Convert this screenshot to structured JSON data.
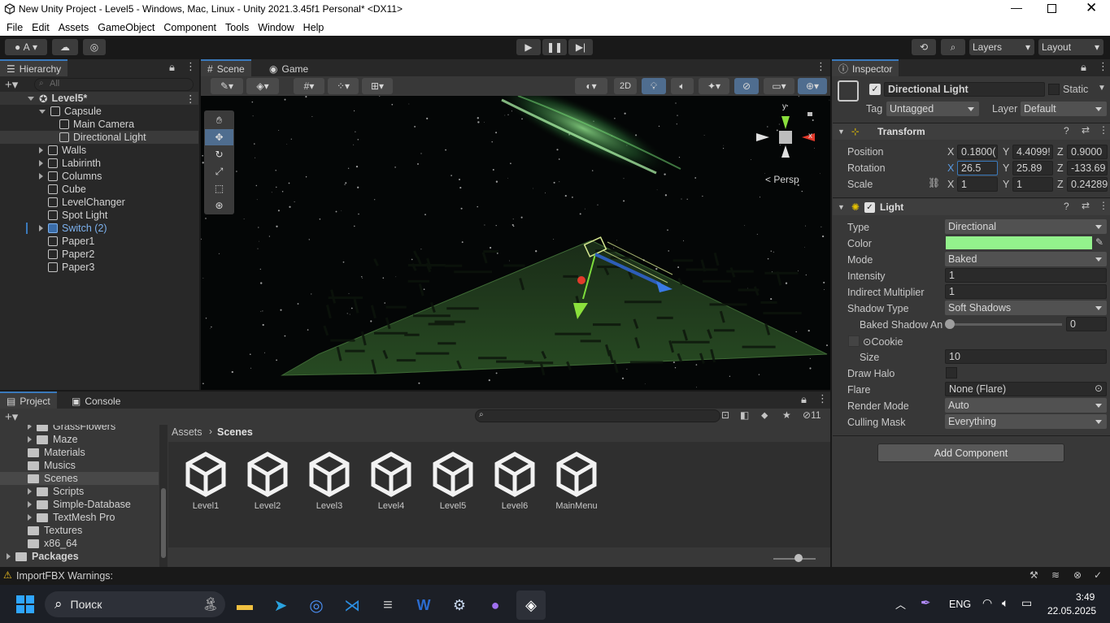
{
  "window": {
    "title": "New Unity Project - Level5 - Windows, Mac, Linux - Unity 2021.3.45f1 Personal* <DX11>"
  },
  "menu": [
    "File",
    "Edit",
    "Assets",
    "GameObject",
    "Component",
    "Tools",
    "Window",
    "Help"
  ],
  "toolbar": {
    "account": "A",
    "layers": "Layers",
    "layout": "Layout"
  },
  "hierarchy": {
    "tab": "Hierarchy",
    "search_placeholder": "All",
    "items": [
      {
        "label": "Level5*",
        "depth": 0,
        "expand": "down",
        "root": true
      },
      {
        "label": "Capsule",
        "depth": 1,
        "expand": "down"
      },
      {
        "label": "Main Camera",
        "depth": 2,
        "expand": ""
      },
      {
        "label": "Directional Light",
        "depth": 2,
        "expand": "",
        "selected": true
      },
      {
        "label": "Walls",
        "depth": 1,
        "expand": "right"
      },
      {
        "label": "Labirinth",
        "depth": 1,
        "expand": "right"
      },
      {
        "label": "Columns",
        "depth": 1,
        "expand": "right"
      },
      {
        "label": "Cube",
        "depth": 1,
        "expand": ""
      },
      {
        "label": "LevelChanger",
        "depth": 1,
        "expand": ""
      },
      {
        "label": "Spot Light",
        "depth": 1,
        "expand": ""
      },
      {
        "label": "Switch (2)",
        "depth": 1,
        "expand": "right",
        "prefab": true
      },
      {
        "label": "Paper1",
        "depth": 1,
        "expand": ""
      },
      {
        "label": "Paper2",
        "depth": 1,
        "expand": ""
      },
      {
        "label": "Paper3",
        "depth": 1,
        "expand": ""
      }
    ]
  },
  "scene": {
    "tab_scene": "Scene",
    "tab_game": "Game",
    "btn_2d": "2D",
    "persp": "Persp",
    "gizmo_y": "y",
    "gizmo_x": "x"
  },
  "inspector": {
    "tab": "Inspector",
    "object_name": "Directional Light",
    "static_label": "Static",
    "tag_label": "Tag",
    "tag_value": "Untagged",
    "layer_label": "Layer",
    "layer_value": "Default",
    "transform": {
      "title": "Transform",
      "position_label": "Position",
      "px": "0.1800(",
      "py": "4.4099!",
      "pz": "0.9000",
      "rotation_label": "Rotation",
      "rx": "26.5",
      "ry": "25.89",
      "rz": "-133.69",
      "scale_label": "Scale",
      "sx": "1",
      "sy": "1",
      "sz": "0.24289",
      "x": "X",
      "y": "Y",
      "z": "Z"
    },
    "light": {
      "title": "Light",
      "type_label": "Type",
      "type_value": "Directional",
      "color_label": "Color",
      "color_hex": "#93f28c",
      "mode_label": "Mode",
      "mode_value": "Baked",
      "intensity_label": "Intensity",
      "intensity_value": "1",
      "indirect_label": "Indirect Multiplier",
      "indirect_value": "1",
      "shadow_label": "Shadow Type",
      "shadow_value": "Soft Shadows",
      "baked_shadow_label": "Baked Shadow An",
      "baked_shadow_value": "0",
      "cookie_label": "Cookie",
      "size_label": "Size",
      "size_value": "10",
      "halo_label": "Draw Halo",
      "flare_label": "Flare",
      "flare_value": "None (Flare)",
      "render_label": "Render Mode",
      "render_value": "Auto",
      "culling_label": "Culling Mask",
      "culling_value": "Everything"
    },
    "add_component": "Add Component"
  },
  "project": {
    "tab_project": "Project",
    "tab_console": "Console",
    "tree": [
      {
        "label": "GrassFlowers",
        "depth": 1,
        "expand": "right"
      },
      {
        "label": "Maze",
        "depth": 1,
        "expand": "right"
      },
      {
        "label": "Materials",
        "depth": 1,
        "expand": ""
      },
      {
        "label": "Musics",
        "depth": 1,
        "expand": ""
      },
      {
        "label": "Scenes",
        "depth": 1,
        "expand": "",
        "selected": true
      },
      {
        "label": "Scripts",
        "depth": 1,
        "expand": "right"
      },
      {
        "label": "Simple-Database",
        "depth": 1,
        "expand": "right"
      },
      {
        "label": "TextMesh Pro",
        "depth": 1,
        "expand": "right"
      },
      {
        "label": "Textures",
        "depth": 1,
        "expand": ""
      },
      {
        "label": "x86_64",
        "depth": 1,
        "expand": ""
      },
      {
        "label": "Packages",
        "depth": 0,
        "expand": "right",
        "bold": true
      }
    ],
    "breadcrumb_root": "Assets",
    "breadcrumb_current": "Scenes",
    "hidden_count": "11",
    "assets": [
      "Level1",
      "Level2",
      "Level3",
      "Level4",
      "Level5",
      "Level6",
      "MainMenu"
    ]
  },
  "status": {
    "warning": "ImportFBX Warnings:"
  },
  "taskbar": {
    "search": "Поиск",
    "lang": "ENG",
    "time": "3:49",
    "date": "22.05.2025"
  }
}
